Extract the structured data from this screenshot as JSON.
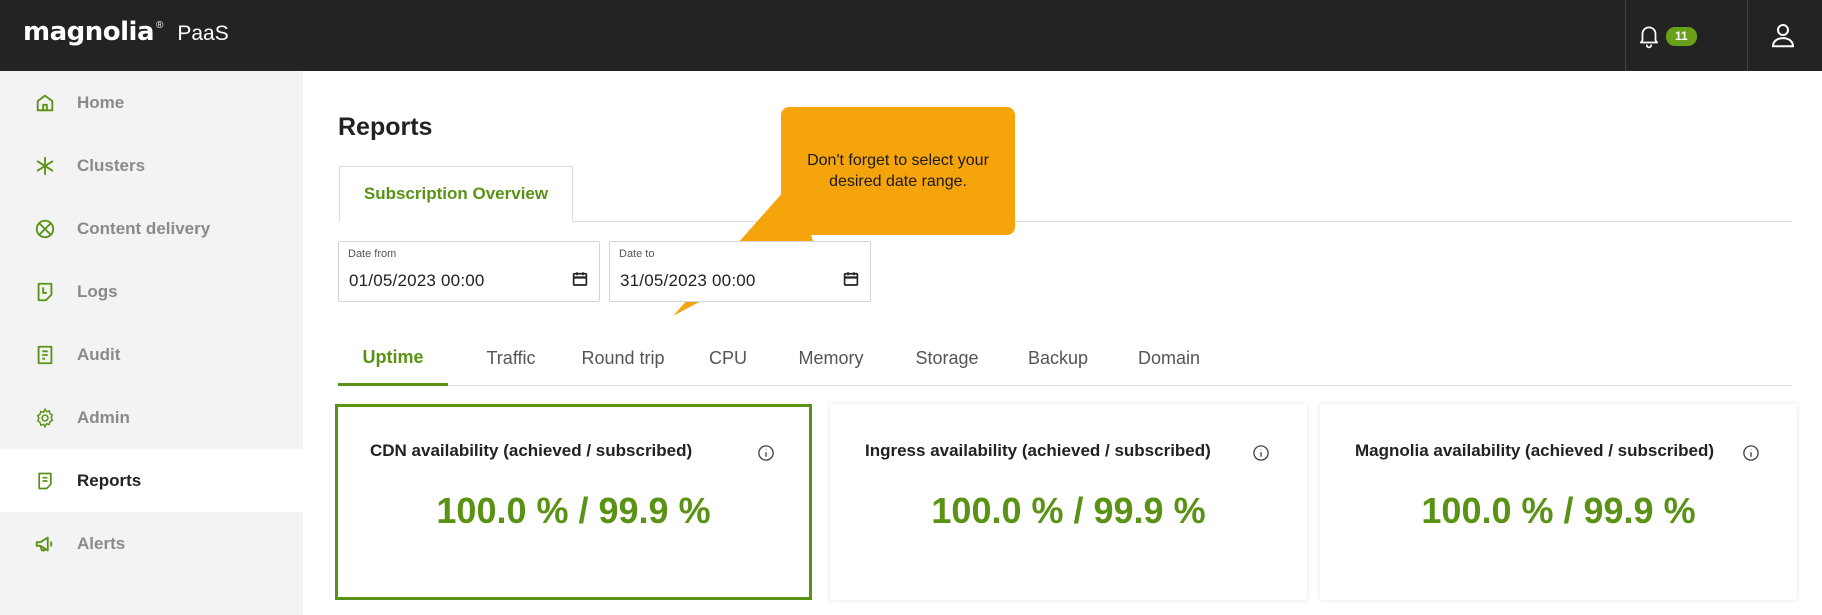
{
  "header": {
    "logo_text": "magnolia",
    "logo_reg": "®",
    "product": "PaaS",
    "notifications_count": "11"
  },
  "sidebar": {
    "items": [
      {
        "label": "Home",
        "icon": "home-icon"
      },
      {
        "label": "Clusters",
        "icon": "asterisk-icon"
      },
      {
        "label": "Content delivery",
        "icon": "cdn-icon"
      },
      {
        "label": "Logs",
        "icon": "logs-icon"
      },
      {
        "label": "Audit",
        "icon": "audit-icon"
      },
      {
        "label": "Admin",
        "icon": "gear-icon"
      },
      {
        "label": "Reports",
        "icon": "report-icon",
        "active": true
      },
      {
        "label": "Alerts",
        "icon": "megaphone-icon"
      }
    ]
  },
  "page": {
    "title": "Reports",
    "subtab": "Subscription Overview",
    "tooltip": "Don't forget to select your desired date range.",
    "date_from": {
      "label": "Date from",
      "value": "01/05/2023 00:00"
    },
    "date_to": {
      "label": "Date to",
      "value": "31/05/2023 00:00"
    },
    "tabs": [
      "Uptime",
      "Traffic",
      "Round trip",
      "CPU",
      "Memory",
      "Storage",
      "Backup",
      "Domain"
    ],
    "active_tab": "Uptime",
    "cards": [
      {
        "title": "CDN availability (achieved / subscribed)",
        "value": "100.0 % / 99.9 %"
      },
      {
        "title": "Ingress availability (achieved / subscribed)",
        "value": "100.0 % / 99.9 %"
      },
      {
        "title": "Magnolia availability (achieved / subscribed)",
        "value": "100.0 % / 99.9 %"
      }
    ]
  },
  "colors": {
    "header_bg": "#232323",
    "accent_green": "#5a9215",
    "badge_green": "#6a9f1b",
    "tooltip_orange": "#f5a40b"
  }
}
